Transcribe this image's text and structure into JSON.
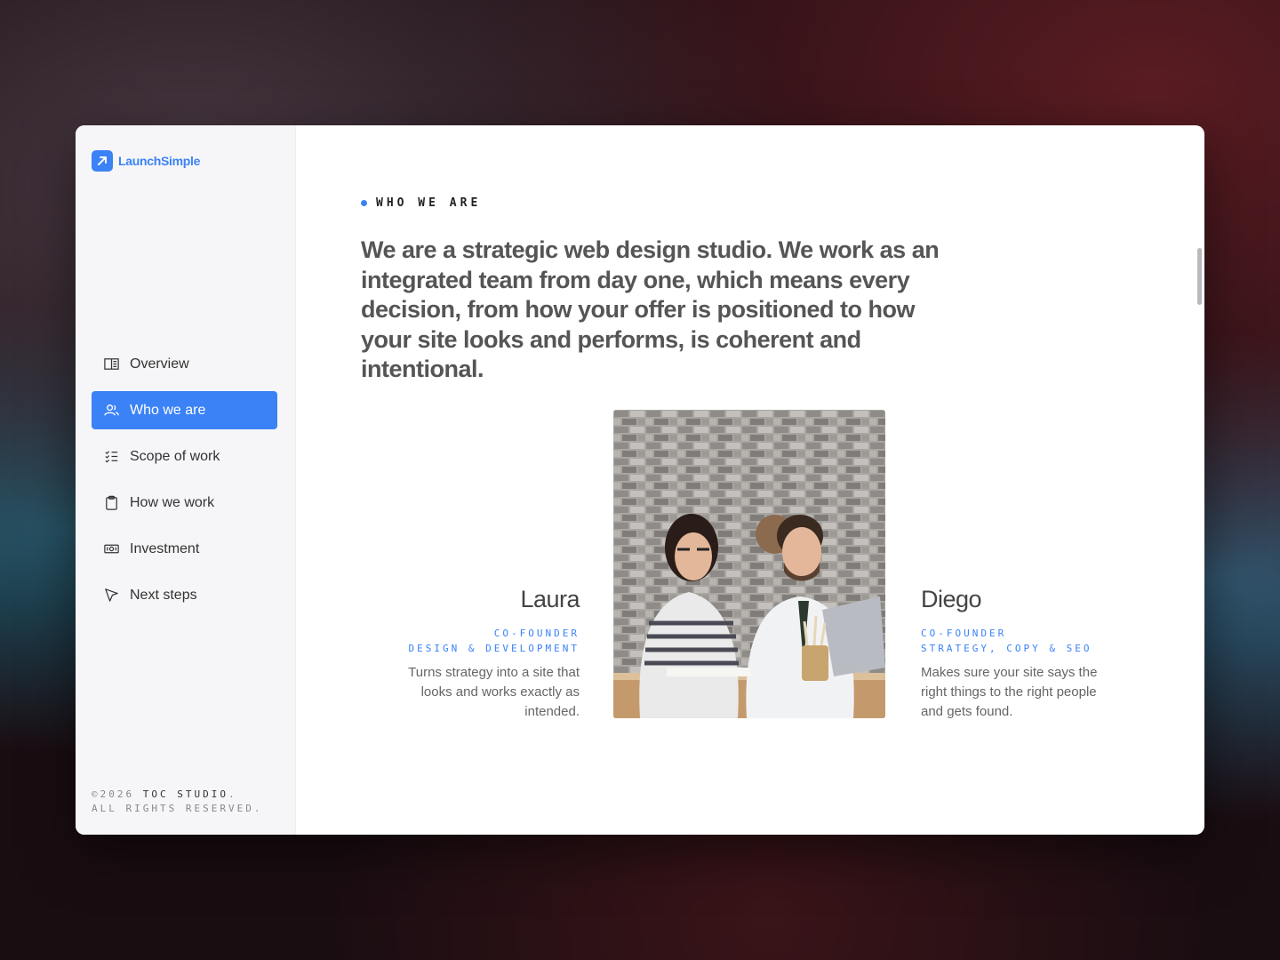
{
  "brand": {
    "name": "LaunchSimple"
  },
  "sidebar": {
    "items": [
      {
        "label": "Overview",
        "icon": "book-open-icon",
        "active": false
      },
      {
        "label": "Who we are",
        "icon": "users-icon",
        "active": true
      },
      {
        "label": "Scope of work",
        "icon": "list-checks-icon",
        "active": false
      },
      {
        "label": "How we work",
        "icon": "clipboard-icon",
        "active": false
      },
      {
        "label": "Investment",
        "icon": "banknote-icon",
        "active": false
      },
      {
        "label": "Next steps",
        "icon": "cursor-pointer-icon",
        "active": false
      }
    ],
    "copyright_year": "©2026",
    "copyright_studio": "TOC STUDIO",
    "copyright_rest": "ALL RIGHTS RESERVED."
  },
  "section": {
    "eyebrow": "WHO WE ARE",
    "headline": "We are a strategic web design studio. We work as an integrated team from day one, which means every decision, from how your offer is positioned to how your site looks and performs, is coherent and intentional."
  },
  "team": [
    {
      "name": "Laura",
      "role_line1": "CO-FOUNDER",
      "role_line2": "DESIGN & DEVELOPMENT",
      "bio": "Turns strategy into a site that looks and works exactly as intended."
    },
    {
      "name": "Diego",
      "role_line1": "CO-FOUNDER",
      "role_line2": "STRATEGY, COPY & SEO",
      "bio": "Makes sure your site says the right things to the right people and gets found."
    }
  ],
  "colors": {
    "accent": "#3b82f6",
    "sidebar_bg": "#f6f6f8"
  }
}
